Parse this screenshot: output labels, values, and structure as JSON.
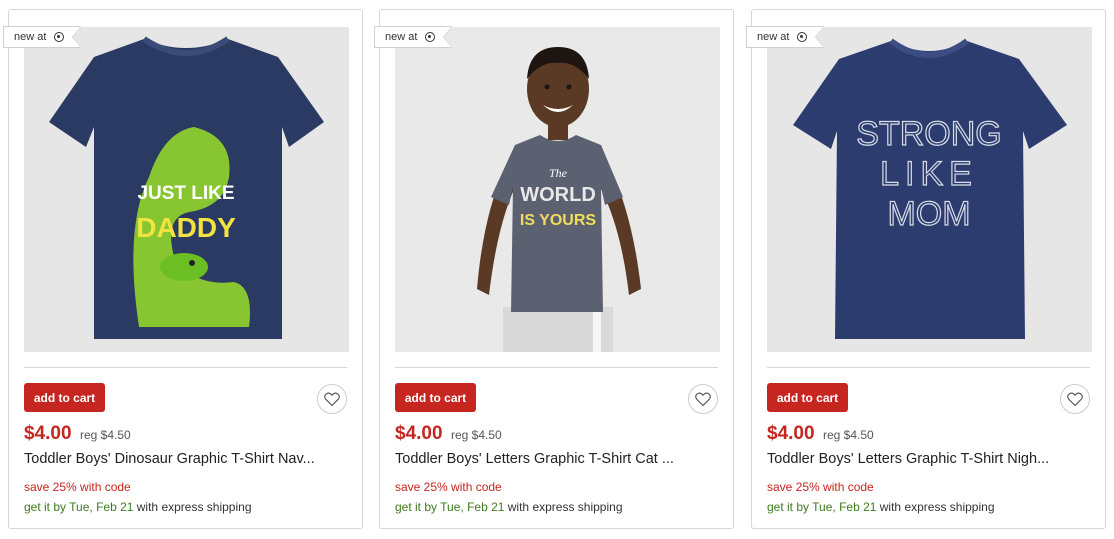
{
  "colors": {
    "accent_red": "#c62520",
    "ship_green": "#3d7b1f",
    "border": "#d6d6d6"
  },
  "products": [
    {
      "badge": "new at",
      "badge_icon": "target-bullseye-icon",
      "shirt_text_1": "JUST LIKE",
      "shirt_text_2": "DADDY",
      "add_to_cart": "add to cart",
      "favorite_icon": "heart-icon",
      "price": "$4.00",
      "reg_price": "reg $4.50",
      "title": "Toddler Boys' Dinosaur Graphic T-Shirt Nav...",
      "promo": "save 25% with code",
      "ship_prefix": "get it by",
      "ship_day": "Tue",
      "ship_date": "Feb 21",
      "ship_suffix": "with express shipping"
    },
    {
      "badge": "new at",
      "badge_icon": "target-bullseye-icon",
      "shirt_text_1": "The",
      "shirt_text_2": "WORLD",
      "shirt_text_3": "IS YOURS",
      "add_to_cart": "add to cart",
      "favorite_icon": "heart-icon",
      "price": "$4.00",
      "reg_price": "reg $4.50",
      "title": "Toddler Boys' Letters Graphic T-Shirt Cat ...",
      "promo": "save 25% with code",
      "ship_prefix": "get it by",
      "ship_day": "Tue",
      "ship_date": "Feb 21",
      "ship_suffix": "with express shipping"
    },
    {
      "badge": "new at",
      "badge_icon": "target-bullseye-icon",
      "shirt_text_1": "STRONG",
      "shirt_text_2": "LIKE",
      "shirt_text_3": "MOM",
      "add_to_cart": "add to cart",
      "favorite_icon": "heart-icon",
      "price": "$4.00",
      "reg_price": "reg $4.50",
      "title": "Toddler Boys' Letters Graphic T-Shirt Nigh...",
      "promo": "save 25% with code",
      "ship_prefix": "get it by",
      "ship_day": "Tue",
      "ship_date": "Feb 21",
      "ship_suffix": "with express shipping"
    }
  ]
}
